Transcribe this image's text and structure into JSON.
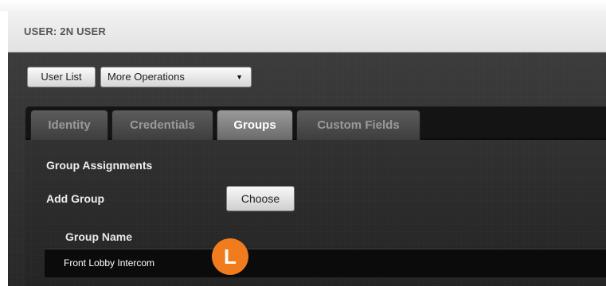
{
  "header": {
    "title": "USER: 2N USER"
  },
  "toolbar": {
    "user_list_label": "User List",
    "more_operations_label": "More Operations",
    "dropdown_arrow": "▼"
  },
  "tabs": [
    {
      "label": "Identity",
      "active": false
    },
    {
      "label": "Credentials",
      "active": false
    },
    {
      "label": "Groups",
      "active": true
    },
    {
      "label": "Custom Fields",
      "active": false
    }
  ],
  "groups_panel": {
    "section_title": "Group Assignments",
    "add_group_label": "Add Group",
    "choose_label": "Choose",
    "table": {
      "columns": [
        "Group Name"
      ],
      "rows": [
        {
          "group_name": "Front Lobby Intercom"
        }
      ]
    }
  },
  "callout": {
    "label": "L",
    "color": "#f07c1e"
  },
  "colors": {
    "panel_dark": "#2e2e2e",
    "tab_active": "#8a8a8a",
    "title_bar": "#e8e8e8"
  }
}
